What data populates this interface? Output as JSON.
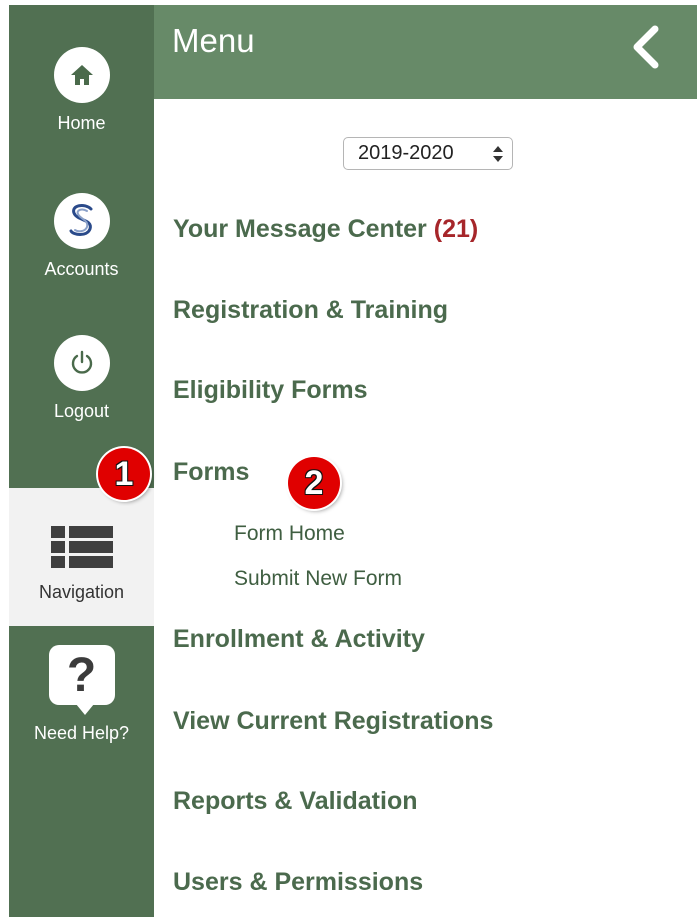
{
  "header": {
    "title": "Menu"
  },
  "sidebar": {
    "items": [
      {
        "label": "Home",
        "icon": "home-icon"
      },
      {
        "label": "Accounts",
        "icon": "accounts-logo-icon"
      },
      {
        "label": "Logout",
        "icon": "power-icon"
      },
      {
        "label": "Navigation",
        "icon": "list-icon"
      },
      {
        "label": "Need Help?",
        "icon": "question-bubble-icon"
      }
    ]
  },
  "year_select": {
    "value": "2019-2020"
  },
  "menu": {
    "message_center": {
      "label": "Your Message Center",
      "count": "(21)"
    },
    "items": [
      "Registration & Training",
      "Eligibility Forms",
      "Forms",
      "Enrollment & Activity",
      "View Current Registrations",
      "Reports & Validation",
      "Users & Permissions"
    ],
    "forms_subitems": [
      "Form Home",
      "Submit New Form"
    ]
  },
  "annotations": {
    "badge1": "1",
    "badge2": "2"
  },
  "colors": {
    "sidebar": "#517052",
    "header": "#678a68",
    "menu_text": "#4b6a4d",
    "count": "#a6262a",
    "badge": "#e00000"
  }
}
